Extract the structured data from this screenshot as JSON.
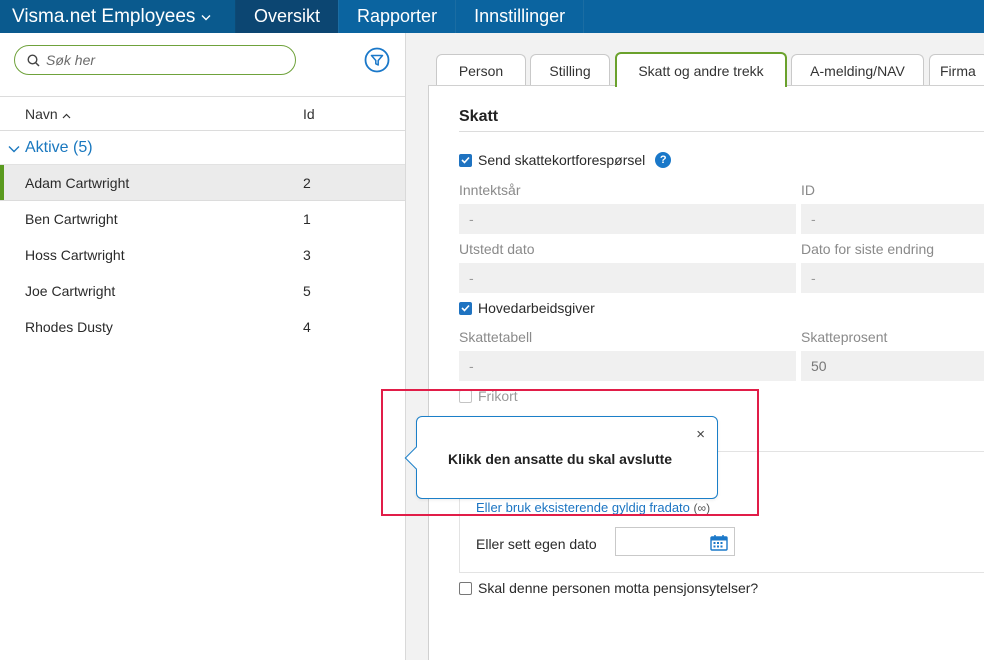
{
  "app": {
    "brand": "Visma.net Employees",
    "brand_caret": "⌄"
  },
  "nav": {
    "items": [
      {
        "label": "Oversikt"
      },
      {
        "label": "Rapporter"
      },
      {
        "label": "Innstillinger"
      }
    ]
  },
  "colors": {
    "nav_bg": "#0b64a0",
    "nav_active": "#0c4672",
    "accent_green": "#6aa12c",
    "link_blue": "#1a78bf",
    "highlight_red": "#e11d48"
  },
  "left": {
    "search": {
      "placeholder": "Søk her",
      "icon": "search-icon"
    },
    "filter_icon": "filter-icon",
    "columns": {
      "name": "Navn",
      "name_sort": "^",
      "id": "Id"
    },
    "group": {
      "label": "Aktive (5)",
      "icon": "chevron-down-icon"
    },
    "employees": [
      {
        "name": "Adam Cartwright",
        "id": "2"
      },
      {
        "name": "Ben Cartwright",
        "id": "1"
      },
      {
        "name": "Hoss Cartwright",
        "id": "3"
      },
      {
        "name": "Joe Cartwright",
        "id": "5"
      },
      {
        "name": "Rhodes Dusty",
        "id": "4"
      }
    ]
  },
  "tabs": [
    {
      "label": "Person"
    },
    {
      "label": "Stilling"
    },
    {
      "label": "Skatt og andre trekk"
    },
    {
      "label": "A-melding/NAV"
    },
    {
      "label": "Firma"
    }
  ],
  "skatt": {
    "title": "Skatt",
    "send_request": {
      "label": "Send skattekortforespørsel",
      "checked": true,
      "help": "?"
    },
    "inntektsar": {
      "label": "Inntektsår",
      "value": "-"
    },
    "id": {
      "label": "ID",
      "value": "-"
    },
    "utstedt": {
      "label": "Utstedt dato",
      "value": "-"
    },
    "siste_endring": {
      "label": "Dato for siste endring",
      "value": "-"
    },
    "hovedarbeidsgiver": {
      "label": "Hovedarbeidsgiver",
      "checked": true
    },
    "skattetabell": {
      "label": "Skattetabell",
      "value": "-"
    },
    "skatteprosent": {
      "label": "Skatteprosent",
      "value": "50"
    },
    "frikort": {
      "label": "Frikort",
      "checked": false
    }
  },
  "fradato": {
    "link": "Eller bruk eksisterende gyldig fradato",
    "link_suffix": "(∞)",
    "own_date_label": "Eller sett egen dato",
    "date_value": "",
    "calendar_icon": "calendar-icon"
  },
  "pension": {
    "label": "Skal denne personen motta pensjonsytelser?",
    "checked": false
  },
  "tooltip": {
    "text": "Klikk den ansatte du skal avslutte",
    "close": "×"
  }
}
